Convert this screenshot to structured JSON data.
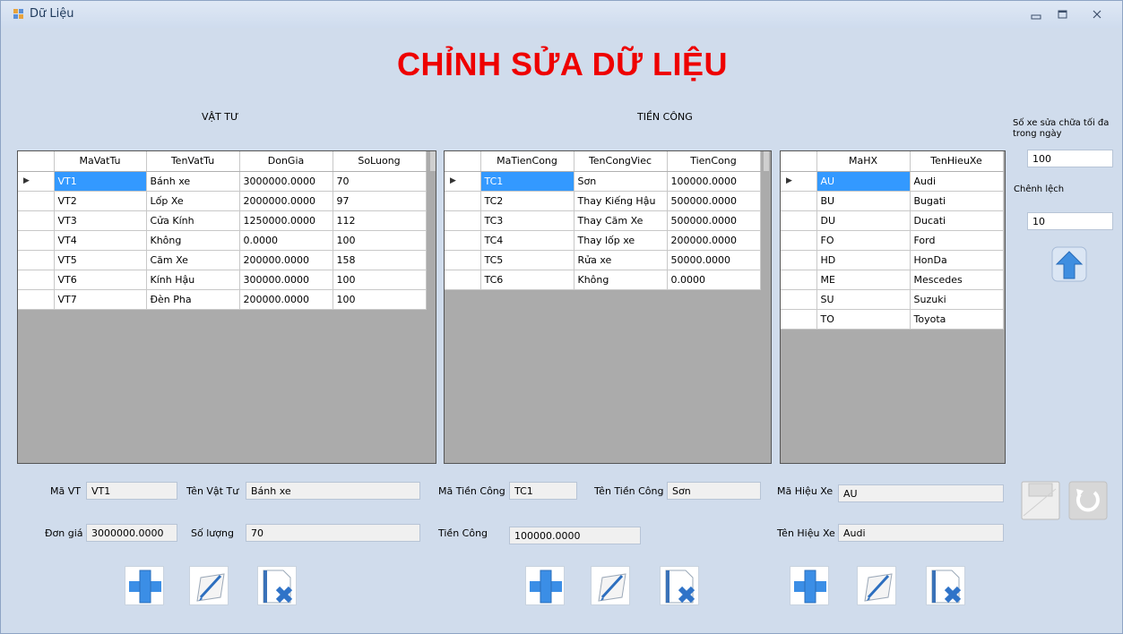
{
  "window": {
    "title": "Dữ Liệu",
    "controls": {
      "minimize": "▭",
      "maximize": "▢",
      "close": "✕"
    }
  },
  "header": {
    "title": "CHỈNH SỬA DỮ LIỆU"
  },
  "colors": {
    "title": "#ee0000",
    "selection": "#3399ff",
    "background": "#d0dcec",
    "grid_empty": "#ababab"
  },
  "vattu": {
    "section_label": "VẬT TƯ",
    "columns": [
      "MaVatTu",
      "TenVatTu",
      "DonGia",
      "SoLuong"
    ],
    "rows": [
      [
        "VT1",
        "Bánh xe",
        "3000000.0000",
        "70"
      ],
      [
        "VT2",
        "Lốp Xe",
        "2000000.0000",
        "97"
      ],
      [
        "VT3",
        "Cửa Kính",
        "1250000.0000",
        "112"
      ],
      [
        "VT4",
        "Không",
        "0.0000",
        "100"
      ],
      [
        "VT5",
        "Căm Xe",
        "200000.0000",
        "158"
      ],
      [
        "VT6",
        "Kính Hậu",
        "300000.0000",
        "100"
      ],
      [
        "VT7",
        "Đèn Pha",
        "200000.0000",
        "100"
      ]
    ],
    "form": {
      "ma_label": "Mã VT",
      "ma_value": "VT1",
      "ten_label": "Tên Vật Tư",
      "ten_value": "Bánh xe",
      "dongia_label": "Đơn giá",
      "dongia_value": "3000000.0000",
      "soluong_label": "Số lượng",
      "soluong_value": "70"
    }
  },
  "tiencong": {
    "section_label": "TIỀN CÔNG",
    "columns": [
      "MaTienCong",
      "TenCongViec",
      "TienCong"
    ],
    "rows": [
      [
        "TC1",
        "Sơn",
        "100000.0000"
      ],
      [
        "TC2",
        "Thay Kiếng Hậu",
        "500000.0000"
      ],
      [
        "TC3",
        "Thay Căm Xe",
        "500000.0000"
      ],
      [
        "TC4",
        "Thay lốp xe",
        "200000.0000"
      ],
      [
        "TC5",
        "Rửa xe",
        "50000.0000"
      ],
      [
        "TC6",
        "Không",
        "0.0000"
      ]
    ],
    "form": {
      "ma_label": "Mã Tiền Công",
      "ma_value": "TC1",
      "ten_label": "Tên Tiền Công",
      "ten_value": "Sơn",
      "tien_label": "Tiền Công",
      "tien_value": "100000.0000"
    }
  },
  "hieuxe": {
    "columns": [
      "MaHX",
      "TenHieuXe"
    ],
    "rows": [
      [
        "AU",
        "Audi"
      ],
      [
        "BU",
        "Bugati"
      ],
      [
        "DU",
        "Ducati"
      ],
      [
        "FO",
        "Ford"
      ],
      [
        "HD",
        "HonDa"
      ],
      [
        "ME",
        "Mescedes"
      ],
      [
        "SU",
        "Suzuki"
      ],
      [
        "TO",
        "Toyota"
      ]
    ],
    "form": {
      "ma_label": "Mã Hiệu Xe",
      "ma_value": "AU",
      "ten_label": "Tên Hiệu Xe",
      "ten_value": "Audi"
    }
  },
  "settings": {
    "max_label": "Số xe sửa chữa tối đa trong ngày",
    "max_value": "100",
    "diff_label": "Chênh lệch",
    "diff_value": "10"
  },
  "icons": {
    "add": "plus-icon",
    "edit": "pencil-icon",
    "delete": "delete-icon",
    "upload": "arrow-up-icon",
    "save": "save-icon",
    "refresh": "refresh-icon"
  }
}
